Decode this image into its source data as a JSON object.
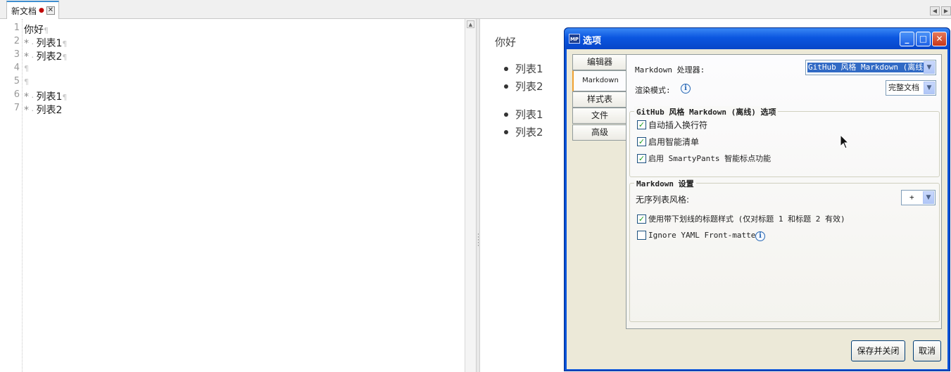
{
  "tab": {
    "title": "新文档",
    "modified_mark": "●",
    "close_glyph": "✕"
  },
  "scroll_arrows": {
    "left": "◀",
    "right": "▶"
  },
  "editor": {
    "lines": [
      {
        "num": "1",
        "text": "你好",
        "marker": "¶"
      },
      {
        "num": "2",
        "bullet": "*",
        "text": "列表1",
        "marker": "¶"
      },
      {
        "num": "3",
        "bullet": "*",
        "text": "列表2",
        "marker": "¶"
      },
      {
        "num": "4",
        "text": "",
        "marker": "¶"
      },
      {
        "num": "5",
        "text": "",
        "marker": "¶"
      },
      {
        "num": "6",
        "bullet": "*",
        "text": "列表1",
        "marker": "¶"
      },
      {
        "num": "7",
        "bullet": "*",
        "text": "列表2",
        "marker": ""
      }
    ]
  },
  "preview": {
    "heading": "你好",
    "list1": [
      "列表1",
      "列表2"
    ],
    "list2": [
      "列表1",
      "列表2"
    ]
  },
  "dialog": {
    "title": "选项",
    "app_icon": "MP",
    "buttons": {
      "min": "_",
      "max": "□",
      "close": "✕"
    },
    "tabs": [
      "编辑器",
      "Markdown",
      "样式表",
      "文件",
      "高级"
    ],
    "active_tab": "Markdown",
    "processor_label": "Markdown 处理器:",
    "processor_value": "GitHub 风格 Markdown (离线)",
    "render_mode_label": "渲染模式:",
    "render_mode_value": "完整文档",
    "info_glyph": "i",
    "group1": {
      "title": "GitHub 风格 Markdown (离线) 选项",
      "options": [
        {
          "label": "自动插入换行符",
          "checked": true
        },
        {
          "label": "启用智能清单",
          "checked": true
        },
        {
          "label": "启用 SmartyPants 智能标点功能",
          "checked": true
        }
      ]
    },
    "group2": {
      "title": "Markdown 设置",
      "list_style_label": "无序列表风格:",
      "list_style_value": "+",
      "underline_heading": {
        "label": "使用带下划线的标题样式 (仅对标题 1 和标题 2 有效)",
        "checked": true
      },
      "ignore_yaml": {
        "label": "Ignore YAML Front-matter",
        "checked": false
      }
    },
    "save_button": "保存并关闭",
    "cancel_button": "取消"
  }
}
